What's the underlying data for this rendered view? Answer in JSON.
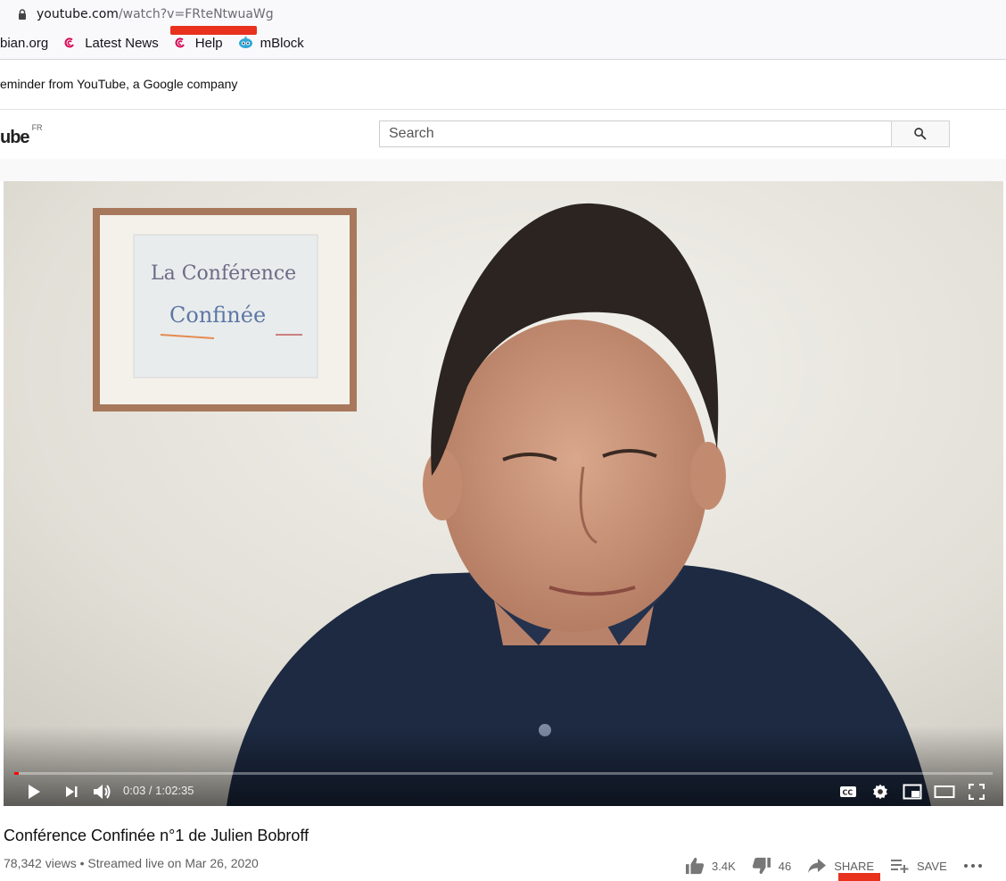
{
  "browser": {
    "url_host": "youtube.com",
    "url_path": "/watch?v=FRteNtwuaWg",
    "bookmarks": [
      {
        "label": "bian.org"
      },
      {
        "label": "Latest News"
      },
      {
        "label": "Help"
      },
      {
        "label": "mBlock"
      }
    ]
  },
  "reminder": {
    "text": "eminder from YouTube, a Google company"
  },
  "header": {
    "logo_text": "ube",
    "logo_region": "FR",
    "search_placeholder": "Search"
  },
  "player": {
    "time_display": "0:03 / 1:02:35",
    "progress_fraction": 0.0008,
    "frame_text": {
      "line1": "La Conférence",
      "line2": "Confinée"
    }
  },
  "video": {
    "title": "Conférence Confinée n°1 de Julien Bobroff",
    "meta": "78,342 views • Streamed live on Mar 26, 2020",
    "likes": "3.4K",
    "dislikes": "46",
    "share_label": "SHARE",
    "save_label": "SAVE"
  },
  "colors": {
    "redmark": "#e8321e",
    "progress": "#ff0000"
  }
}
